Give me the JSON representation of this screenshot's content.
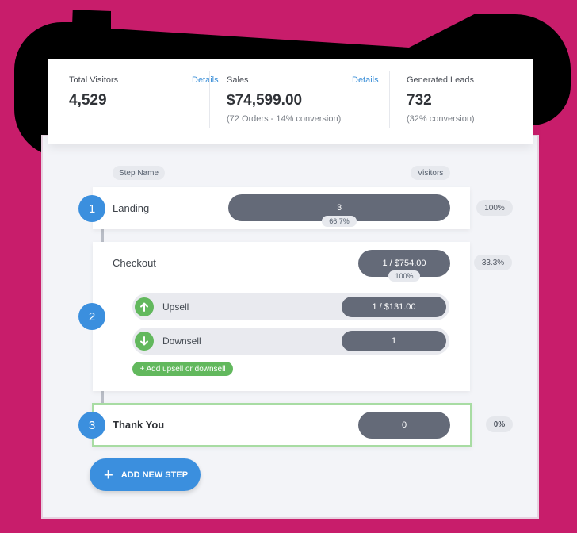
{
  "stats": [
    {
      "label": "Total Visitors",
      "link": "Details",
      "value": "4,529",
      "sub": ""
    },
    {
      "label": "Sales",
      "link": "Details",
      "value": "$74,599.00",
      "sub": "(72 Orders - 14% conversion)"
    },
    {
      "label": "Generated Leads",
      "link": "",
      "value": "732",
      "sub": "(32% conversion)"
    }
  ],
  "headers": {
    "step_name": "Step Name",
    "visitors": "Visitors"
  },
  "steps": [
    {
      "number": "1",
      "name": "Landing",
      "bar_value": "3",
      "sub_pct": "66.7%",
      "pct": "100%"
    },
    {
      "number": "2",
      "name": "Checkout",
      "bar_value": "1 / $754.00",
      "sub_pct": "100%",
      "pct": "33.3%",
      "substeps": [
        {
          "name": "Upsell",
          "value": "1 / $131.00",
          "icon": "arrow-up-icon"
        },
        {
          "name": "Downsell",
          "value": "1",
          "icon": "arrow-down-icon"
        }
      ],
      "add_sub_label": "+ Add upsell or downsell"
    },
    {
      "number": "3",
      "name": "Thank You",
      "bar_value": "0",
      "pct": "0%"
    }
  ],
  "add_step_label": "ADD NEW STEP",
  "colors": {
    "accent": "#3b8fde",
    "green": "#62b85d",
    "bar": "#646a78",
    "background": "#c81d6b"
  }
}
